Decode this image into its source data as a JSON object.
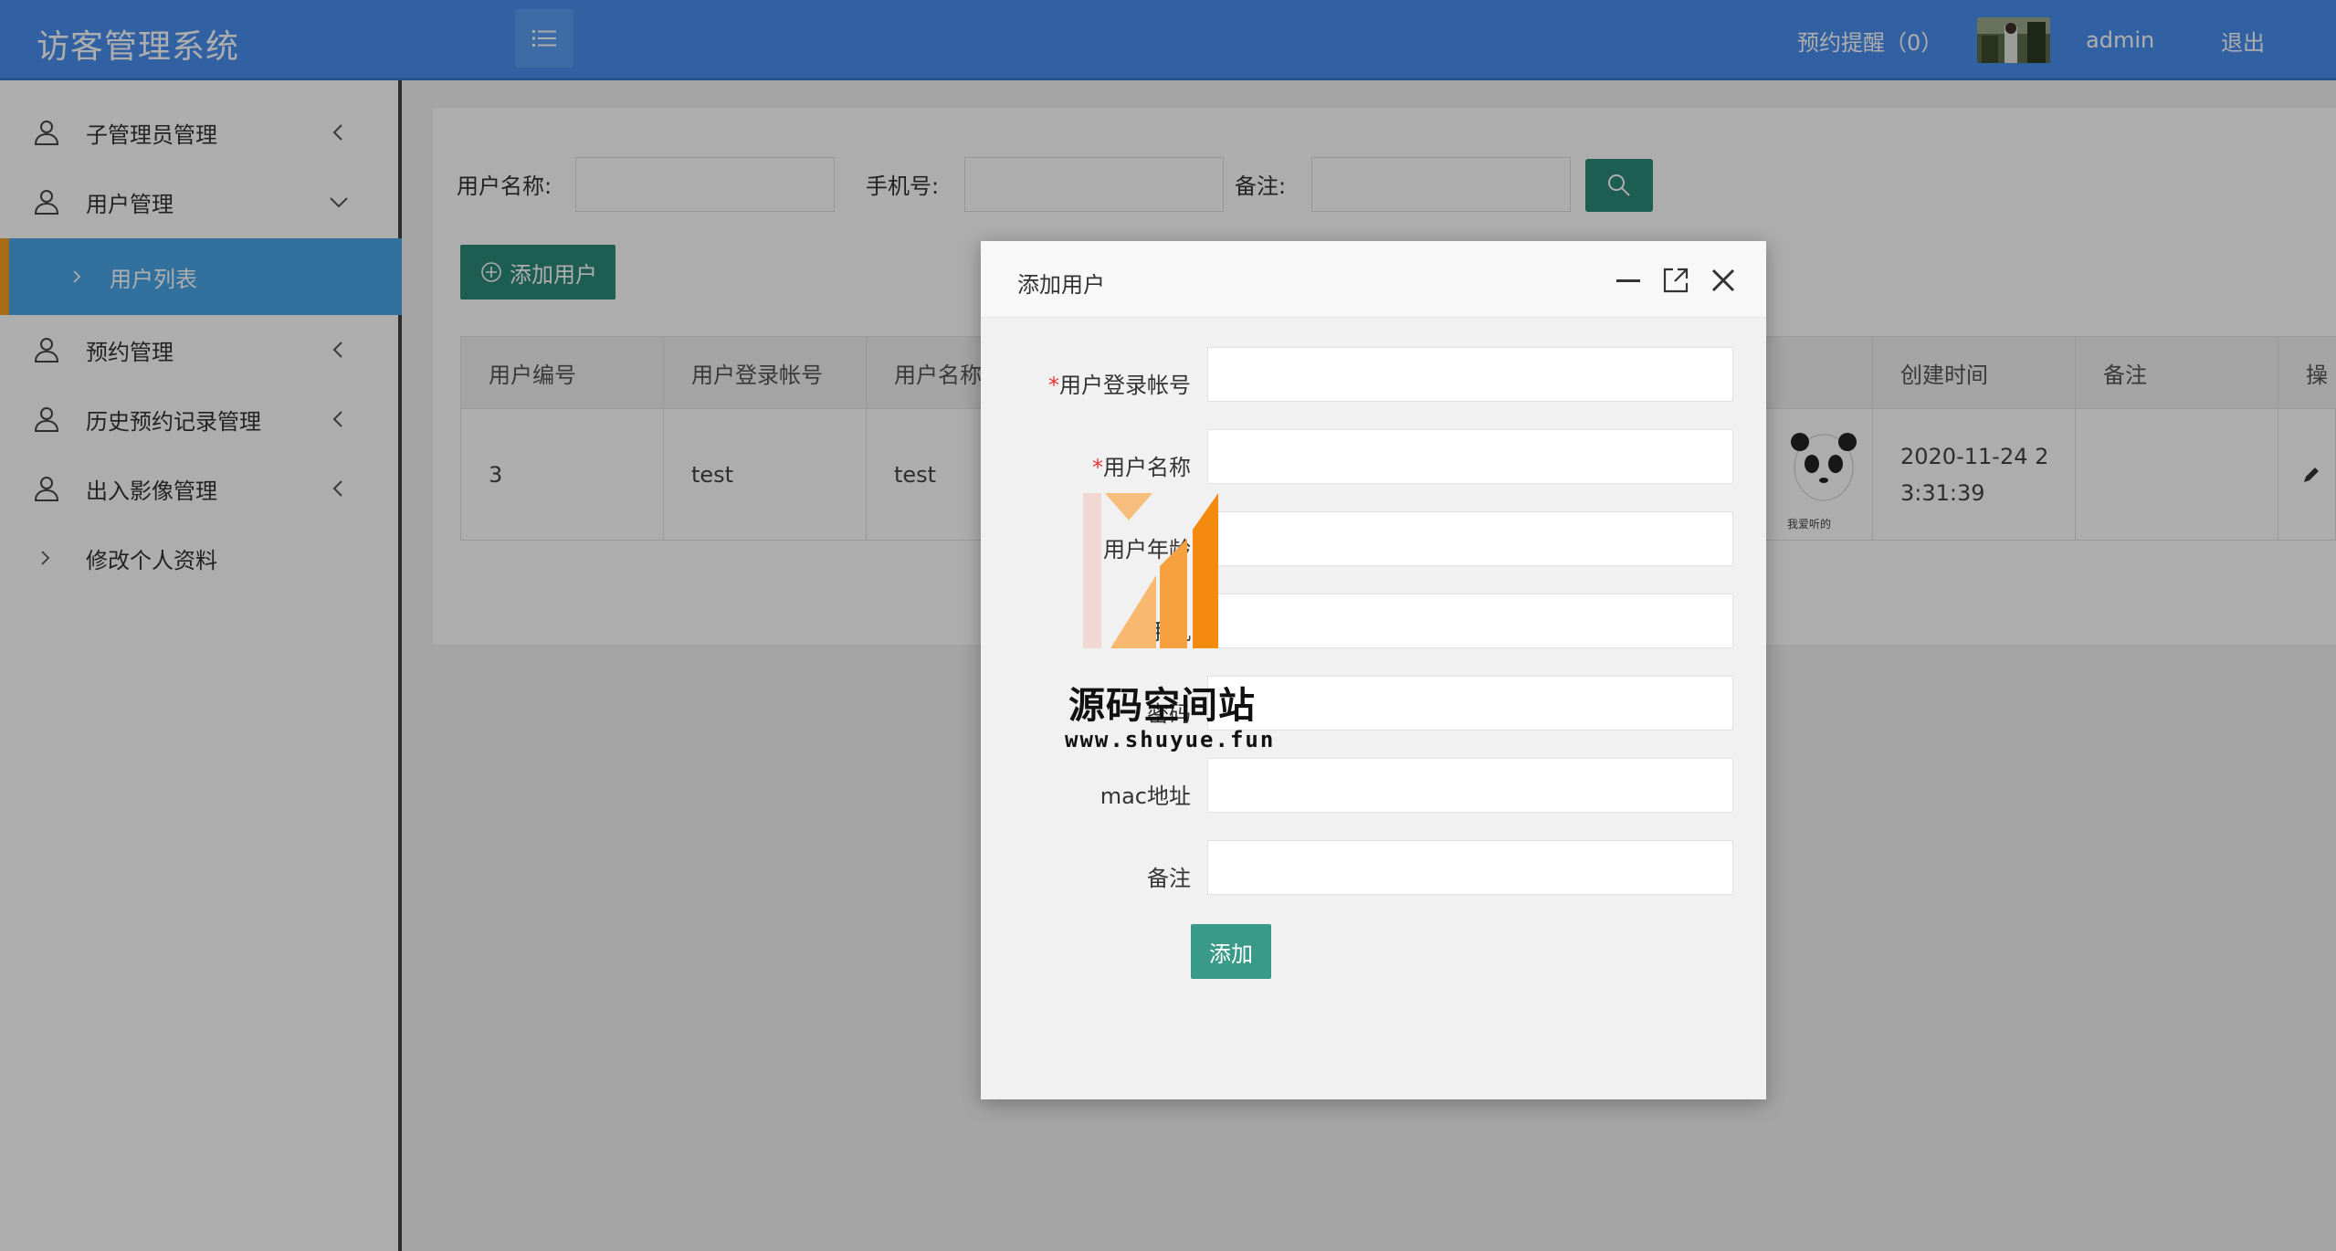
{
  "header": {
    "app_title": "访客管理系统",
    "reminder": "预约提醒（0）",
    "username": "admin",
    "logout": "退出"
  },
  "sidebar": {
    "items": [
      {
        "label": "子管理员管理",
        "icon": "user-icon",
        "chevron": "chevron-left-icon"
      },
      {
        "label": "用户管理",
        "icon": "user-icon",
        "chevron": "chevron-down-icon"
      },
      {
        "label": "用户列表",
        "icon": "chevron-right-icon",
        "active": true
      },
      {
        "label": "预约管理",
        "icon": "user-icon",
        "chevron": "chevron-left-icon"
      },
      {
        "label": "历史预约记录管理",
        "icon": "user-icon",
        "chevron": "chevron-left-icon"
      },
      {
        "label": "出入影像管理",
        "icon": "user-icon",
        "chevron": "chevron-left-icon"
      },
      {
        "label": "修改个人资料",
        "icon": "chevron-right-icon"
      }
    ]
  },
  "search": {
    "username_label": "用户名称:",
    "phone_label": "手机号:",
    "remark_label": "备注:"
  },
  "toolbar": {
    "add_user_label": "添加用户"
  },
  "table": {
    "headers": [
      "用户编号",
      "用户登录帐号",
      "用户名称",
      "创建时间",
      "备注",
      "操"
    ],
    "rows": [
      {
        "id": "3",
        "account": "test",
        "name": "test",
        "created_line1": "2020-11-24 2",
        "created_line2": "3:31:39",
        "remark": "",
        "image_caption": "我爱听的"
      }
    ]
  },
  "modal": {
    "title": "添加用户",
    "fields": [
      {
        "label": "用户登录帐号",
        "required": true
      },
      {
        "label": "用户名称",
        "required": true
      },
      {
        "label": "用户年龄",
        "required": false
      },
      {
        "label": "手机",
        "required": true
      },
      {
        "label": "密码",
        "required": false
      },
      {
        "label": "mac地址",
        "required": false
      },
      {
        "label": "备注",
        "required": false
      }
    ],
    "required_mark": "*",
    "submit_label": "添加"
  },
  "watermark": {
    "title": "源码空间站",
    "url": "www.shuyue.fun"
  },
  "colors": {
    "header_bg": "#4a90f0",
    "active_nav": "#4aa6e8",
    "active_marker": "#f0a020",
    "primary_button": "#2d8a78",
    "required": "#e33333"
  }
}
